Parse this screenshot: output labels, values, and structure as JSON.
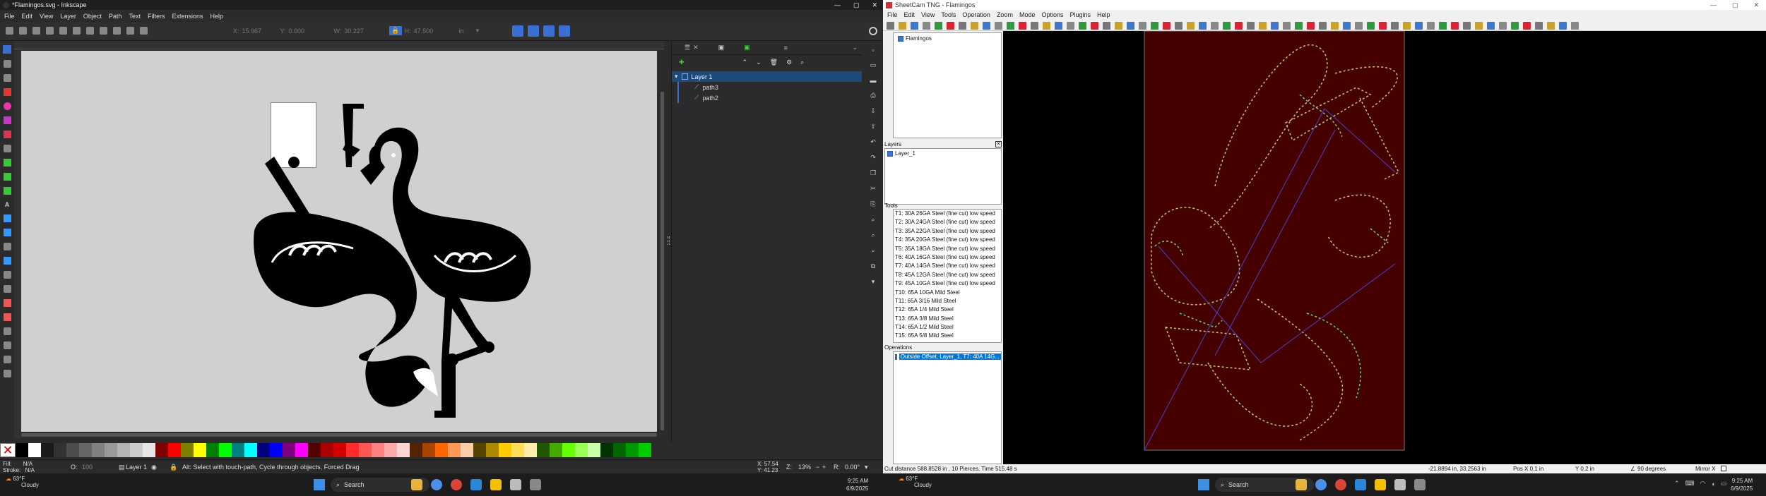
{
  "inkscape": {
    "title": "*Flamingos.svg - Inkscape",
    "menu": [
      "File",
      "Edit",
      "View",
      "Layer",
      "Object",
      "Path",
      "Text",
      "Filters",
      "Extensions",
      "Help"
    ],
    "coords": {
      "x_label": "X:",
      "x": "15.967",
      "y_label": "Y:",
      "y": "0.000",
      "w_label": "W:",
      "w": "30.227",
      "h_label": "H:",
      "h": "47.500",
      "unit": "in"
    },
    "layers": {
      "layer": "Layer 1",
      "items": [
        "path3",
        "path2"
      ]
    },
    "status": {
      "fill_label": "Fill:",
      "fill": "N/A",
      "stroke_label": "Stroke:",
      "stroke": "N/A",
      "opacity_label": "O:",
      "opacity": "100",
      "layer": "Layer 1",
      "message": "Alt: Select with touch-path, Cycle through objects, Forced Drag",
      "x_label": "X:",
      "x": "57.54",
      "y_label": "Y:",
      "y": "41.23",
      "zoom_label": "Z:",
      "zoom": "13%",
      "rotate_label": "R:",
      "rotate": "0.00°"
    },
    "palette": [
      "#000000",
      "#ffffff",
      "#1a1a1a",
      "#333333",
      "#4d4d4d",
      "#666666",
      "#808080",
      "#999999",
      "#b3b3b3",
      "#cccccc",
      "#e6e6e6",
      "#800000",
      "#ff0000",
      "#808000",
      "#ffff00",
      "#008000",
      "#00ff00",
      "#008080",
      "#00ffff",
      "#000080",
      "#0000ff",
      "#800080",
      "#ff00ff",
      "#550000",
      "#aa0000",
      "#d40000",
      "#ff2a2a",
      "#ff5555",
      "#ff8080",
      "#ffaaaa",
      "#ffd5d5",
      "#552200",
      "#aa4400",
      "#ff6600",
      "#ff9955",
      "#ffccaa",
      "#554400",
      "#aa8800",
      "#ffcc00",
      "#ffdd55",
      "#ffeeaa",
      "#225500",
      "#44aa00",
      "#66ff00",
      "#99ff55",
      "#ccffaa",
      "#003300",
      "#006600",
      "#009900",
      "#00cc00"
    ]
  },
  "sheetcam": {
    "title": "SheetCam TNG - Flamingos",
    "menu": [
      "File",
      "Edit",
      "View",
      "Tools",
      "Operation",
      "Zoom",
      "Mode",
      "Options",
      "Plugins",
      "Help"
    ],
    "parts_header": "Parts",
    "parts": [
      "Flamingos"
    ],
    "layers_header": "Layers",
    "layers": [
      "Layer_1"
    ],
    "tools_header": "Tools",
    "tools": [
      "T1: 30A 26GA Steel (fine cut) low speed",
      "T2: 30A 24GA Steel (fine cut) low speed",
      "T3: 35A 22GA Steel (fine cut) low speed",
      "T4: 35A 20GA Steel (fine cut) low speed",
      "T5: 35A 18GA Steel (fine cut) low speed",
      "T6: 40A 16GA Steel (fine cut) low speed",
      "T7: 40A 14GA Steel (fine cut) low speed",
      "T8: 45A 12GA Steel (fine cut) low speed",
      "T9: 45A 10GA Steel (fine cut) low speed",
      "T10: 65A 10GA Mild Steel",
      "T11: 65A 3/16 Mild Steel",
      "T12: 65A 1/4 Mild Steel",
      "T13: 65A 3/8 Mild Steel",
      "T14: 65A 1/2 Mild Steel",
      "T15: 65A 5/8 Mild Steel"
    ],
    "operations_header": "Operations",
    "operations": [
      "Outside Offset, Layer_1, T7: 40A 14G..."
    ],
    "status": {
      "cut": "Cut distance 588.8528 in , 10 Pierces, Time 515.48 s",
      "coords": "-21.8894 in, 33.2563 in",
      "pos_x": "Pos X  0.1 in",
      "pos_y": "Y  0.2 in",
      "angle": "90 degrees",
      "mirror": "Mirror X"
    }
  },
  "taskbar": {
    "weather_temp": "63°F",
    "weather_text": "Cloudy",
    "search": "Search",
    "time": "9:25 AM",
    "date": "6/9/2025"
  }
}
